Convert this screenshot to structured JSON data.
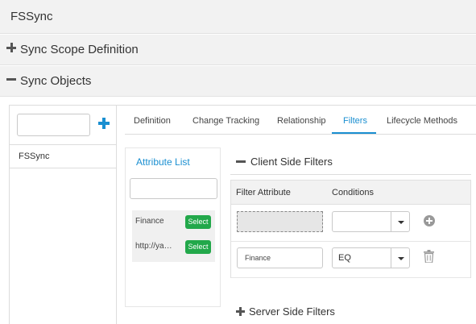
{
  "app": {
    "title": "FSSync"
  },
  "accordions": {
    "scope": {
      "label": "Sync Scope Definition",
      "state": "collapsed"
    },
    "objects": {
      "label": "Sync Objects",
      "state": "expanded"
    }
  },
  "left_panel": {
    "search": {
      "placeholder": ""
    },
    "items": [
      {
        "label": "FSSync"
      }
    ]
  },
  "tabs": [
    {
      "label": "Definition"
    },
    {
      "label": "Change Tracking"
    },
    {
      "label": "Relationship"
    },
    {
      "label": "Filters",
      "active": true
    },
    {
      "label": "Lifecycle Methods"
    }
  ],
  "attribute_list": {
    "title": "Attribute List",
    "search": {
      "placeholder": ""
    },
    "items": [
      {
        "label": "Finance",
        "button": "Select"
      },
      {
        "label": "http://ya…",
        "button": "Select"
      }
    ]
  },
  "client_filters": {
    "title": "Client Side Filters",
    "columns": [
      "Filter Attribute",
      "Conditions"
    ],
    "rows": [
      {
        "attribute": "",
        "condition": "",
        "action": "add-icon"
      },
      {
        "attribute": "Finance",
        "condition": "EQ",
        "action": "trash-icon"
      }
    ]
  },
  "server_filters": {
    "title": "Server Side Filters",
    "state": "collapsed"
  },
  "colors": {
    "accent": "#1a8fd1",
    "select_button": "#22a84a",
    "header_bg": "#f2f2f2"
  }
}
